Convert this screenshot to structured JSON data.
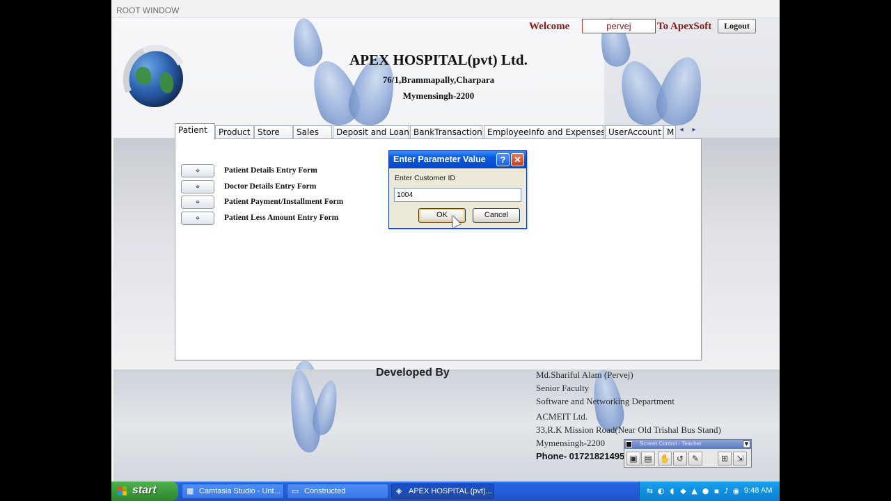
{
  "window": {
    "caption": "ROOT WINDOW"
  },
  "header": {
    "hospital_name": "APEX  HOSPITAL(pvt) Ltd.",
    "address_line1": "76/1,Brammapally,Charpara",
    "address_line2": "Mymensingh-2200",
    "welcome_label": "Welcome",
    "username": "pervej",
    "to_label": "To ApexSoft",
    "logout_label": "Logout"
  },
  "tabs": [
    {
      "label": "Patient",
      "active": true
    },
    {
      "label": "Product"
    },
    {
      "label": "Store"
    },
    {
      "label": "Sales"
    },
    {
      "label": "Deposit and Loan"
    },
    {
      "label": "BankTransaction"
    },
    {
      "label": "EmployeeInfo and Expenses"
    },
    {
      "label": "UserAccount"
    },
    {
      "label": "M"
    }
  ],
  "patient_forms": [
    {
      "label": "Patient Details Entry Form",
      "icon": "binoculars-icon"
    },
    {
      "label": "Doctor Details Entry Form",
      "icon": "binoculars-icon"
    },
    {
      "label": "Patient Payment/Installment Form",
      "icon": "binoculars-icon"
    },
    {
      "label": "Patient Less Amount Entry Form",
      "icon": "binoculars-icon"
    }
  ],
  "dialog": {
    "title": "Enter Parameter Value",
    "help_glyph": "?",
    "close_glyph": "✕",
    "prompt": "Enter Customer ID",
    "value": "1004",
    "ok_label": "OK",
    "cancel_label": "Cancel"
  },
  "footer": {
    "developed_by": "Developed By",
    "lines": [
      "Md.Shariful Alam (Pervej)",
      "Senior Faculty",
      "Software and Networking Department",
      "ACMEIT Ltd.",
      "33,R.K Mission Road(Near Old Trishal Bus Stand)",
      "Mymensingh-2200"
    ],
    "phone": "Phone-  01721821495"
  },
  "screen_control": {
    "title": "Screen Control - Teacher"
  },
  "taskbar": {
    "start_label": "start",
    "items": [
      {
        "label": "Camtasia Studio - Unt...",
        "active": false
      },
      {
        "label": "Constructed",
        "active": false
      },
      {
        "label": "APEX HOSPITAL (pvt)...",
        "active": true
      }
    ],
    "clock": "9:48 AM"
  },
  "colors": {
    "welcome": "#8b1a1a",
    "xp_taskbar": "#245edb",
    "xp_start": "#3c9b3c",
    "dialog_title": "#0a5ce0"
  }
}
